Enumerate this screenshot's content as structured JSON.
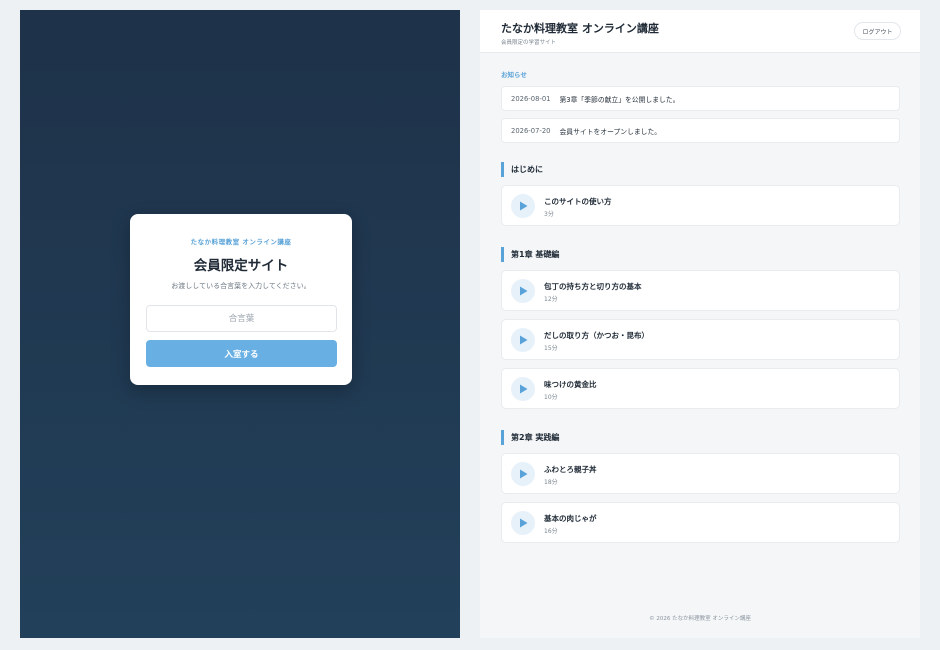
{
  "login": {
    "brand": "たなか料理教室 オンライン講座",
    "title": "会員限定サイト",
    "description": "お渡ししている合言葉を入力してください。",
    "password_placeholder": "合言葉",
    "submit_label": "入室する"
  },
  "header": {
    "title": "たなか料理教室 オンライン講座",
    "subtitle": "会員限定の学習サイト",
    "logout_label": "ログアウト"
  },
  "news": {
    "label": "お知らせ",
    "items": [
      {
        "date": "2026-08-01",
        "text": "第3章「季節の献立」を公開しました。"
      },
      {
        "date": "2026-07-20",
        "text": "会員サイトをオープンしました。"
      }
    ]
  },
  "chapters": [
    {
      "title": "はじめに",
      "lessons": [
        {
          "title": "このサイトの使い方",
          "duration": "3分"
        }
      ]
    },
    {
      "title": "第1章 基礎編",
      "lessons": [
        {
          "title": "包丁の持ち方と切り方の基本",
          "duration": "12分"
        },
        {
          "title": "だしの取り方（かつお・昆布）",
          "duration": "15分"
        },
        {
          "title": "味つけの黄金比",
          "duration": "10分"
        }
      ]
    },
    {
      "title": "第2章 実践編",
      "lessons": [
        {
          "title": "ふわとろ親子丼",
          "duration": "18分"
        },
        {
          "title": "基本の肉じゃが",
          "duration": "16分"
        }
      ]
    }
  ],
  "footer": {
    "text": "© 2026 たなか料理教室 オンライン講座"
  },
  "icons": {
    "lesson": "play-icon"
  },
  "colors": {
    "accent": "#5aa3d8",
    "button": "#68b0e4",
    "login_bg": "#1e3249"
  }
}
